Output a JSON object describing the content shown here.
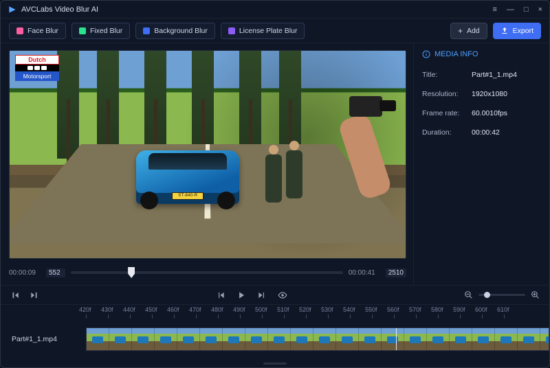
{
  "app": {
    "title": "AVCLabs Video Blur AI"
  },
  "window": {
    "menu": "≡",
    "min": "—",
    "max": "□",
    "close": "×"
  },
  "toolbar": {
    "face": "Face Blur",
    "fixed": "Fixed Blur",
    "background": "Background Blur",
    "plate": "License Plate Blur",
    "add": "Add",
    "export": "Export"
  },
  "watermark": {
    "top": "Dutch",
    "bottom": "Motorsport"
  },
  "plate_text": "ST-840-R",
  "scrub": {
    "current_tc": "00:00:09",
    "current_frame": "552",
    "end_tc": "00:00:41",
    "end_frame": "2510"
  },
  "media_info": {
    "title": "MEDIA INFO",
    "rows": {
      "title": {
        "k": "Title:",
        "v": "Part#1_1.mp4"
      },
      "resolution": {
        "k": "Resolution:",
        "v": "1920x1080"
      },
      "framerate": {
        "k": "Frame rate:",
        "v": "60.0010fps"
      },
      "duration": {
        "k": "Duration:",
        "v": "00:00:42"
      }
    }
  },
  "ruler": [
    "420f",
    "430f",
    "440f",
    "450f",
    "460f",
    "470f",
    "480f",
    "490f",
    "500f",
    "510f",
    "520f",
    "530f",
    "540f",
    "550f",
    "560f",
    "570f",
    "580f",
    "590f",
    "600f",
    "610f"
  ],
  "timeline": {
    "clip_name": "Part#1_1.mp4",
    "playhead_left_pct": 67
  },
  "colors": {
    "face": "#ff5ea0",
    "fixed": "#2ce28c",
    "background": "#3f6df3",
    "plate": "#8b5cf6",
    "add_icon": "#e6e9ef",
    "export_icon": "#ffffff"
  }
}
